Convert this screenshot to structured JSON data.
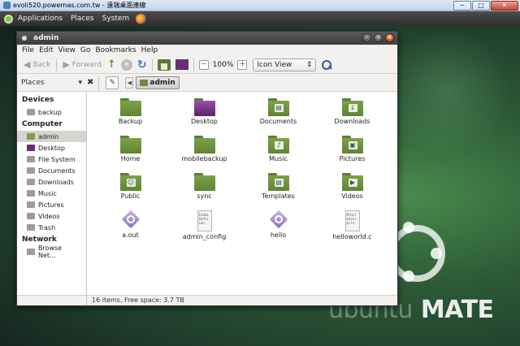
{
  "rdp": {
    "title": "evoli520.powernas.com.tw - 遠端桌面連線",
    "minimize": "─",
    "maximize": "□",
    "close": "✕"
  },
  "panel": {
    "applications": "Applications",
    "places": "Places",
    "system": "System"
  },
  "window": {
    "title": "admin",
    "controls": {
      "minimize": "–",
      "maximize": "+",
      "close": "×"
    }
  },
  "menubar": [
    "File",
    "Edit",
    "View",
    "Go",
    "Bookmarks",
    "Help"
  ],
  "toolbar": {
    "back": "Back",
    "forward": "Forward",
    "zoom_level": "100%",
    "view_mode": "Icon View",
    "icons": [
      "back-arrow-icon",
      "forward-arrow-icon",
      "up-arrow-icon",
      "stop-icon",
      "reload-icon",
      "home-icon",
      "computer-icon",
      "zoom-out-icon",
      "zoom-in-icon",
      "search-icon"
    ]
  },
  "location": {
    "pane_select": "Places",
    "breadcrumb": "admin"
  },
  "sidebar": {
    "sections": [
      {
        "heading": "Devices",
        "items": [
          {
            "label": "backup",
            "icon": "drive-icon"
          }
        ]
      },
      {
        "heading": "Computer",
        "items": [
          {
            "label": "admin",
            "icon": "home-folder-icon",
            "active": true
          },
          {
            "label": "Desktop",
            "icon": "desktop-icon"
          },
          {
            "label": "File System",
            "icon": "filesystem-icon"
          },
          {
            "label": "Documents",
            "icon": "documents-icon"
          },
          {
            "label": "Downloads",
            "icon": "downloads-icon"
          },
          {
            "label": "Music",
            "icon": "music-icon"
          },
          {
            "label": "Pictures",
            "icon": "pictures-icon"
          },
          {
            "label": "Videos",
            "icon": "videos-icon"
          },
          {
            "label": "Trash",
            "icon": "trash-icon"
          }
        ]
      },
      {
        "heading": "Network",
        "items": [
          {
            "label": "Browse Net...",
            "icon": "network-icon"
          }
        ]
      }
    ]
  },
  "items": [
    {
      "label": "Backup",
      "kind": "folder",
      "emblem": ""
    },
    {
      "label": "Desktop",
      "kind": "folder-desktop",
      "emblem": ""
    },
    {
      "label": "Documents",
      "kind": "folder",
      "emblem": "▤"
    },
    {
      "label": "Downloads",
      "kind": "folder",
      "emblem": "↓"
    },
    {
      "label": "Home",
      "kind": "folder",
      "emblem": ""
    },
    {
      "label": "mobilebackup",
      "kind": "folder",
      "emblem": ""
    },
    {
      "label": "Music",
      "kind": "folder",
      "emblem": "♪"
    },
    {
      "label": "Pictures",
      "kind": "folder",
      "emblem": "▣"
    },
    {
      "label": "Public",
      "kind": "folder",
      "emblem": "☺"
    },
    {
      "label": "sync",
      "kind": "folder",
      "emblem": ""
    },
    {
      "label": "Templates",
      "kind": "folder",
      "emblem": "▤"
    },
    {
      "label": "Videos",
      "kind": "folder",
      "emblem": "▶"
    },
    {
      "label": "a.out",
      "kind": "exec",
      "preview": ""
    },
    {
      "label": "admin_config",
      "kind": "text",
      "preview": "Index\nSetti\nLan"
    },
    {
      "label": "hello",
      "kind": "exec",
      "preview": ""
    },
    {
      "label": "helloworld.c",
      "kind": "text",
      "preview": "#incl\nmain(\nprin"
    }
  ],
  "status": "16 items, Free space: 3.7 TB",
  "brand": {
    "text_faint": "ubuntu",
    "text": "MATE"
  },
  "colors": {
    "folder": "#7da24a",
    "accent": "#87c440",
    "selection": "#d6d4d1"
  }
}
